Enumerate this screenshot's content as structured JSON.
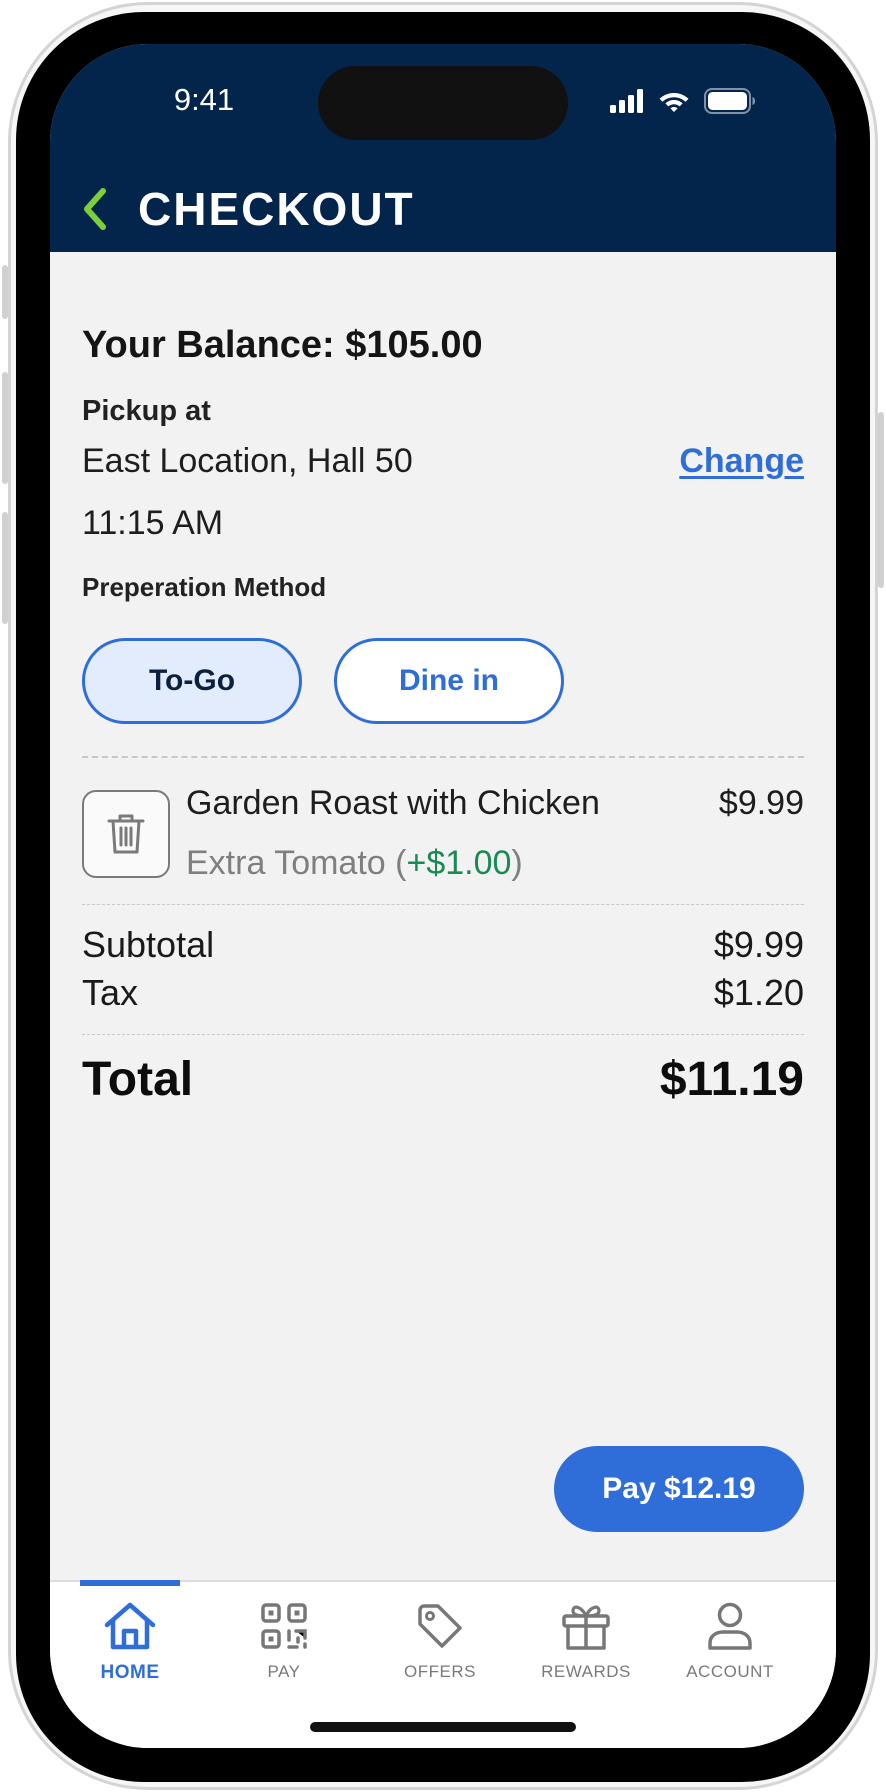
{
  "status_bar": {
    "time": "9:41"
  },
  "header": {
    "title": "CHECKOUT"
  },
  "balance": {
    "text": "Your Balance: $105.00"
  },
  "pickup": {
    "label": "Pickup at",
    "location": "East Location, Hall 50",
    "change_label": "Change",
    "time": "11:15 AM"
  },
  "preparation": {
    "label": "Preperation Method",
    "options": [
      "To-Go",
      "Dine in"
    ],
    "selected": "To-Go"
  },
  "cart": {
    "items": [
      {
        "name": "Garden Roast with Chicken",
        "price": "$9.99",
        "modifier_name": "Extra Tomato",
        "modifier_price": "+$1.00"
      }
    ]
  },
  "summary": {
    "subtotal_label": "Subtotal",
    "subtotal_value": "$9.99",
    "tax_label": "Tax",
    "tax_value": "$1.20",
    "total_label": "Total",
    "total_value": "$11.19"
  },
  "pay_button": {
    "label": "Pay $12.19"
  },
  "tabs": [
    {
      "label": "HOME",
      "icon": "home-icon",
      "active": true
    },
    {
      "label": "PAY",
      "icon": "qr-code-icon",
      "active": false
    },
    {
      "label": "OFFERS",
      "icon": "tag-icon",
      "active": false
    },
    {
      "label": "REWARDS",
      "icon": "gift-icon",
      "active": false
    },
    {
      "label": "ACCOUNT",
      "icon": "user-icon",
      "active": false
    }
  ],
  "colors": {
    "header_bg": "#03254c",
    "accent": "#2f6ed8",
    "back_arrow": "#7bd13a",
    "modifier_price": "#1a8a55",
    "selected_pill_bg": "#e3ecfc"
  }
}
